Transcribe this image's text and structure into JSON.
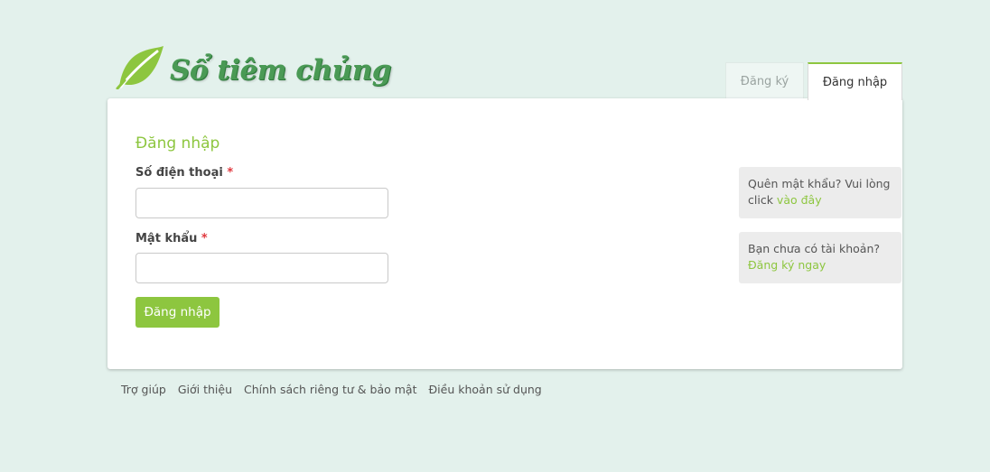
{
  "brand": {
    "name": "Sổ tiêm chủng",
    "logo_icon": "leaf-icon",
    "color": "#4a9a55"
  },
  "tabs": {
    "register": "Đăng ký",
    "login": "Đăng nhập"
  },
  "form": {
    "title": "Đăng nhập",
    "phone_label": "Số điện thoại",
    "password_label": "Mật khẩu",
    "required_mark": "*",
    "phone_value": "",
    "password_value": "",
    "submit_label": "Đăng nhập"
  },
  "side": {
    "forgot_text": "Quên mật khẩu? Vui lòng click",
    "forgot_link": "vào đây",
    "signup_text": "Bạn chưa có tài khoản?",
    "signup_link": "Đăng ký ngay"
  },
  "footer": {
    "links": [
      "Trợ giúp",
      "Giới thiệu",
      "Chính sách riêng tư & bảo mật",
      "Điều khoản sử dụng"
    ]
  },
  "colors": {
    "accent": "#8dc63f",
    "background": "#e3f1ec",
    "required": "#e0383e"
  }
}
